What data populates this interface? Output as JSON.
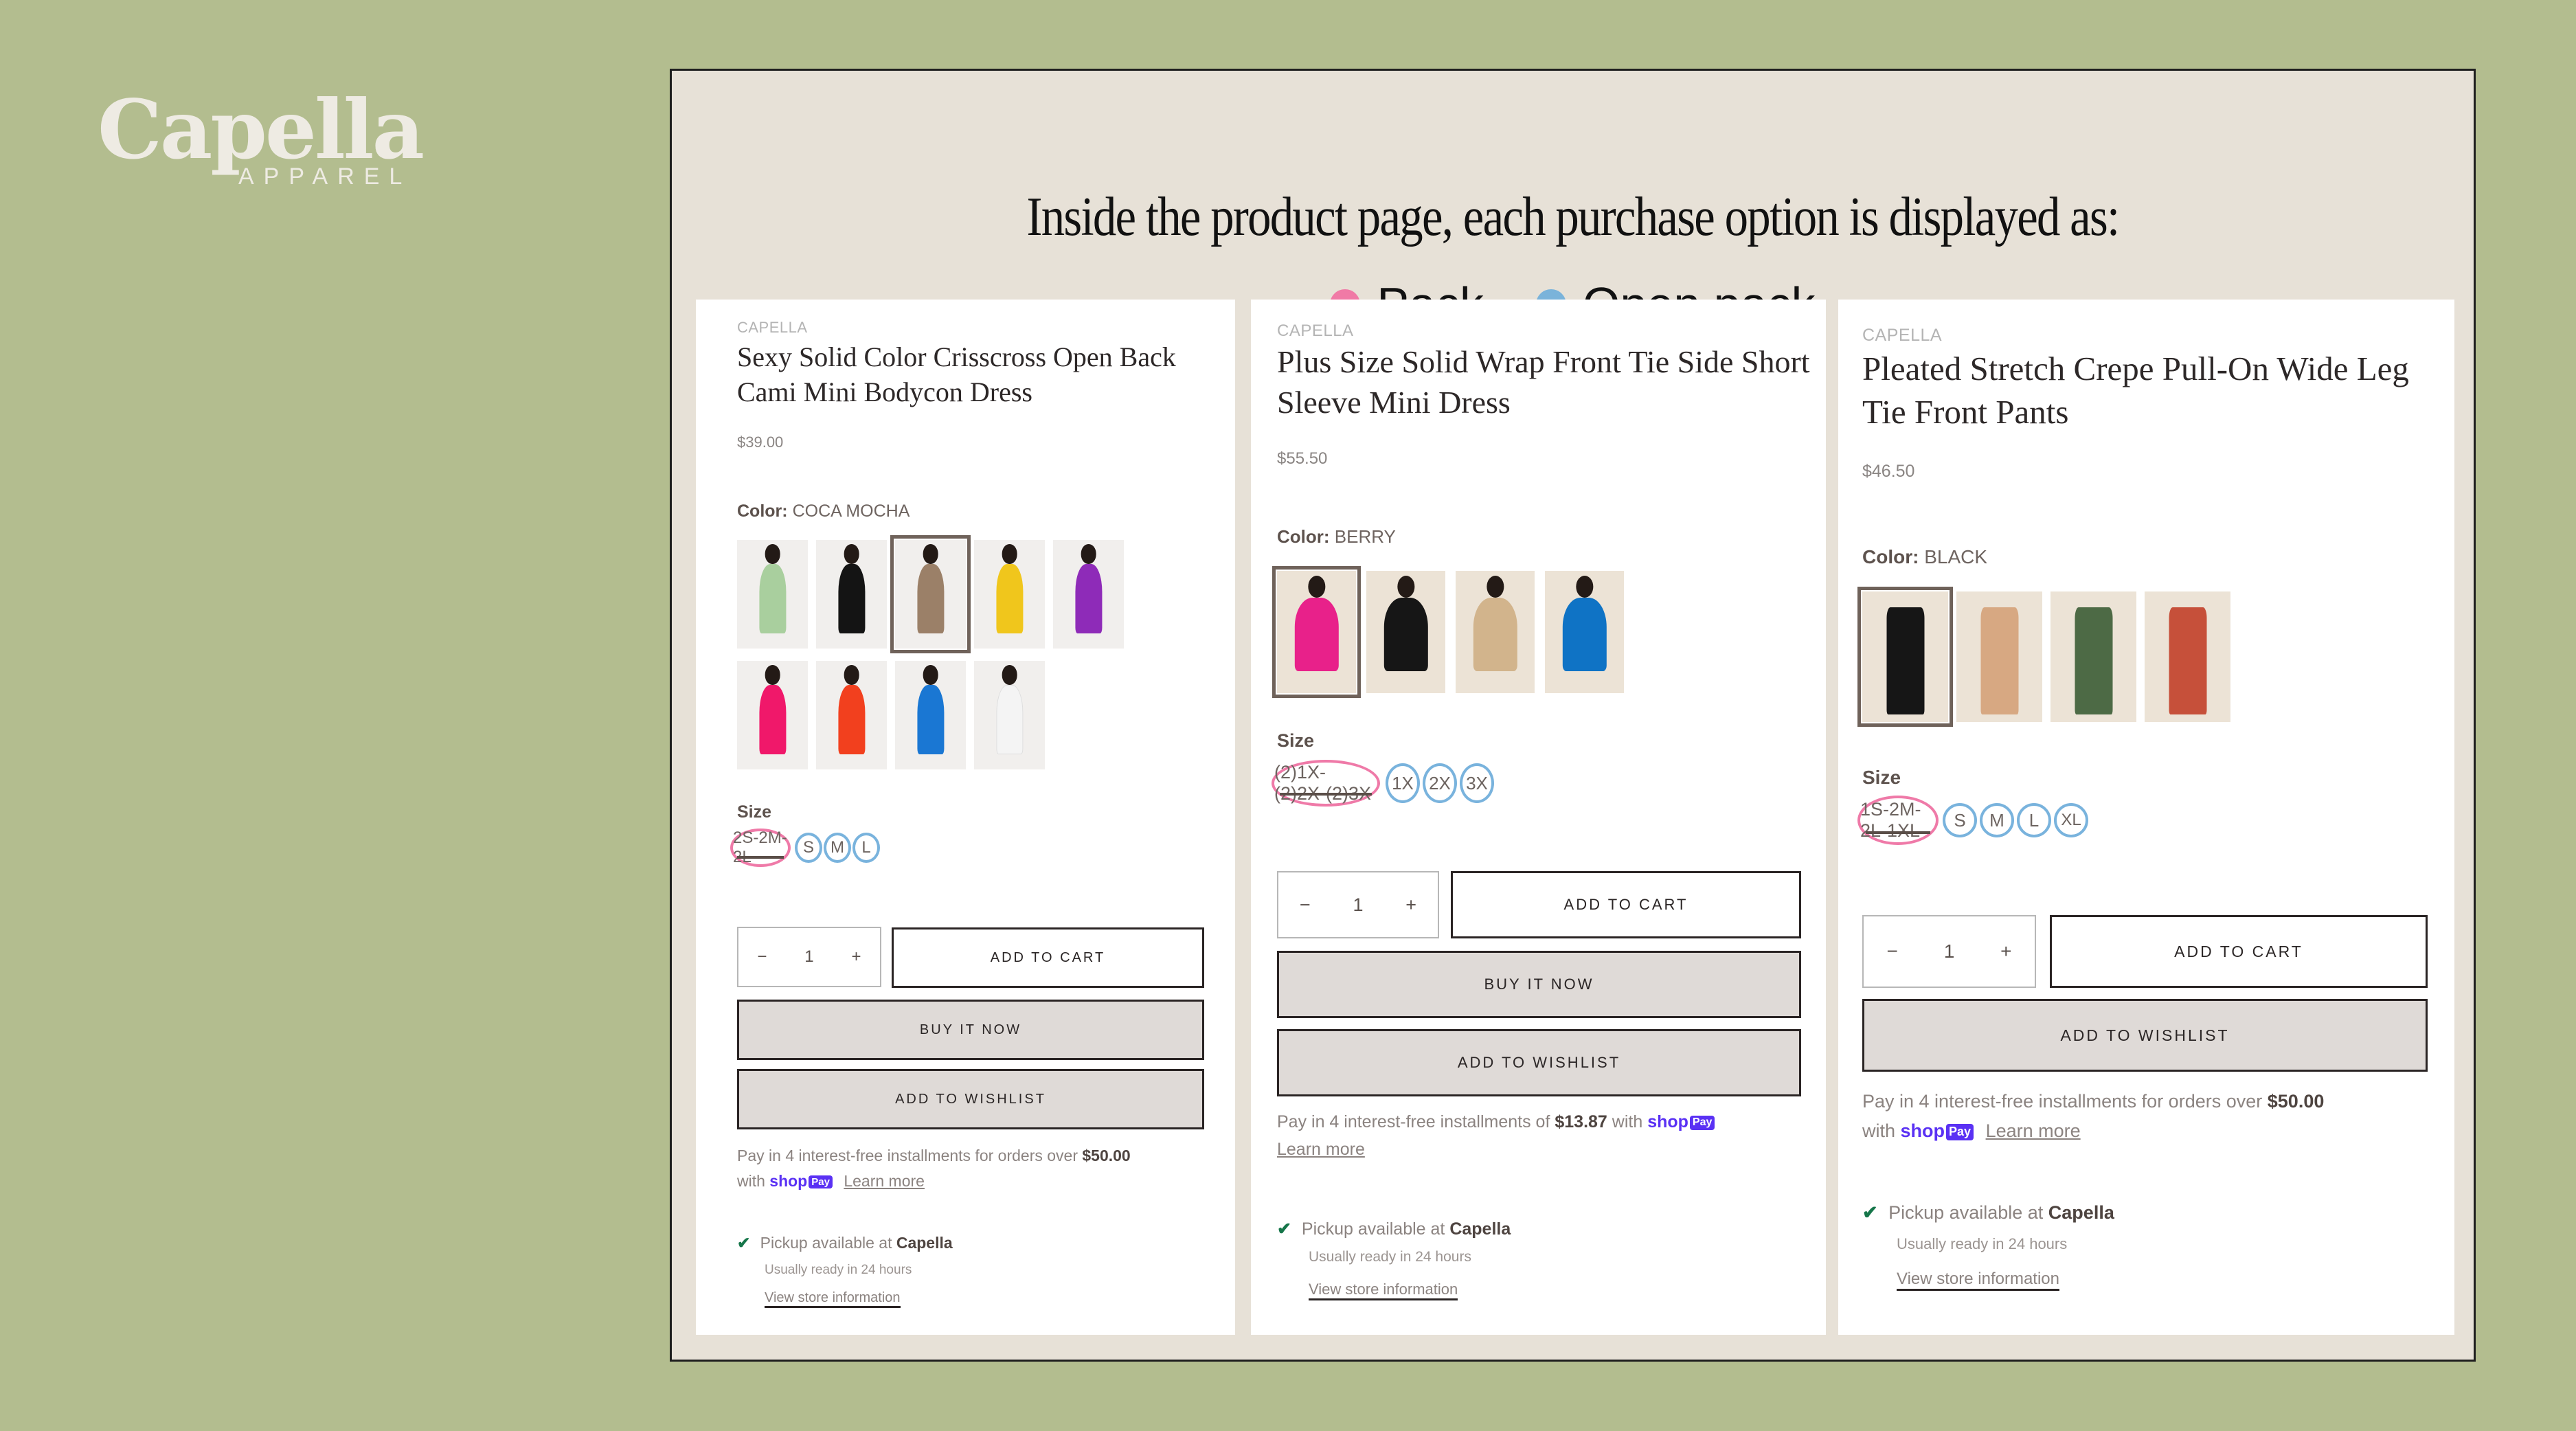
{
  "logo": {
    "main": "Capella",
    "sub": "APPAREL"
  },
  "headline": "Inside the product page, each purchase option is displayed as:",
  "legend": [
    {
      "label": "Pack",
      "color": "#f07aa6"
    },
    {
      "label": "Open pack",
      "color": "#7ab3da"
    }
  ],
  "colors": {
    "pack": "#f07aa6",
    "open_pack": "#7ab3da",
    "shop_pay": "#5a31f4",
    "check": "#16764a"
  },
  "products": [
    {
      "brand": "CAPELLA",
      "title": "Sexy Solid Color Crisscross Open Back Cami Mini Bodycon Dress",
      "price": "$39.00",
      "color_label": "Color:",
      "color_value": "COCA MOCHA",
      "swatches": [
        {
          "name": "sage",
          "color": "#a9cf9e"
        },
        {
          "name": "black",
          "color": "#141414"
        },
        {
          "name": "coca mocha",
          "color": "#9b8068",
          "selected": true
        },
        {
          "name": "yellow",
          "color": "#f0c61c"
        },
        {
          "name": "purple",
          "color": "#8e2bb8"
        },
        {
          "name": "fuchsia",
          "color": "#f0186a"
        },
        {
          "name": "red orange",
          "color": "#f2401e"
        },
        {
          "name": "blue",
          "color": "#1a77d3"
        },
        {
          "name": "white",
          "color": "#f4f4f4"
        }
      ],
      "size_label": "Size",
      "size_pack": "2S-2M-2L",
      "size_open": [
        "S",
        "M",
        "L"
      ],
      "qty": {
        "minus": "−",
        "value": "1",
        "plus": "+"
      },
      "buttons": {
        "add_to_cart": "ADD TO CART",
        "buy_now": "BUY IT NOW",
        "wishlist": "ADD TO WISHLIST"
      },
      "pay": {
        "text": "Pay in 4 interest-free installments for orders over",
        "amount": "$50.00",
        "with": "with",
        "shop": "shop",
        "pay": "Pay",
        "learn": "Learn more"
      },
      "pickup": {
        "text": "Pickup available at",
        "store": "Capella",
        "ready": "Usually ready in 24 hours",
        "link": "View store information"
      }
    },
    {
      "brand": "CAPELLA",
      "title": "Plus Size Solid Wrap Front Tie Side Short Sleeve Mini Dress",
      "price": "$55.50",
      "color_label": "Color:",
      "color_value": "BERRY",
      "swatches": [
        {
          "name": "berry",
          "color": "#e8218a",
          "selected": true
        },
        {
          "name": "black",
          "color": "#161616"
        },
        {
          "name": "taupe",
          "color": "#d2b48c"
        },
        {
          "name": "blue",
          "color": "#0f73c5"
        }
      ],
      "size_label": "Size",
      "size_pack": "(2)1X-(2)2X-(2)3X",
      "size_open": [
        "1X",
        "2X",
        "3X"
      ],
      "qty": {
        "minus": "−",
        "value": "1",
        "plus": "+"
      },
      "buttons": {
        "add_to_cart": "ADD TO CART",
        "buy_now": "BUY IT NOW",
        "wishlist": "ADD TO WISHLIST"
      },
      "pay": {
        "text": "Pay in 4 interest-free installments of",
        "amount": "$13.87",
        "with": "with",
        "shop": "shop",
        "pay": "Pay",
        "learn": "Learn more"
      },
      "pickup": {
        "text": "Pickup available at",
        "store": "Capella",
        "ready": "Usually ready in 24 hours",
        "link": "View store information"
      }
    },
    {
      "brand": "CAPELLA",
      "title": "Pleated Stretch Crepe Pull-On Wide Leg Tie Front Pants",
      "price": "$46.50",
      "color_label": "Color:",
      "color_value": "BLACK",
      "swatches": [
        {
          "name": "black",
          "color": "#161616",
          "selected": true
        },
        {
          "name": "camel",
          "color": "#d7a882"
        },
        {
          "name": "olive",
          "color": "#4d6a45"
        },
        {
          "name": "rust",
          "color": "#c6503a"
        }
      ],
      "size_label": "Size",
      "size_pack": "1S-2M-2L-1XL",
      "size_open": [
        "S",
        "M",
        "L",
        "XL"
      ],
      "qty": {
        "minus": "−",
        "value": "1",
        "plus": "+"
      },
      "buttons": {
        "add_to_cart": "ADD TO CART",
        "wishlist": "ADD TO WISHLIST"
      },
      "pay": {
        "text": "Pay in 4 interest-free installments for orders over",
        "amount": "$50.00",
        "with": "with",
        "shop": "shop",
        "pay": "Pay",
        "learn": "Learn more"
      },
      "pickup": {
        "text": "Pickup available at",
        "store": "Capella",
        "ready": "Usually ready in 24 hours",
        "link": "View store information"
      }
    }
  ]
}
